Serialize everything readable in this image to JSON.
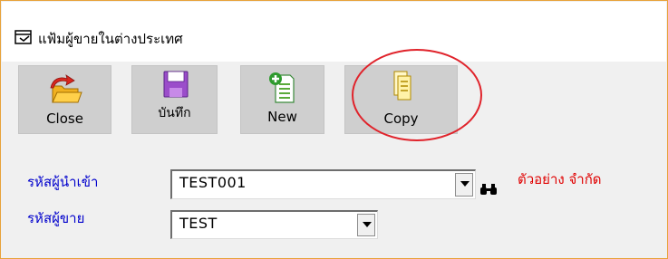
{
  "window": {
    "title": "แฟ้มผู้ขายในต่างประเทศ",
    "icon": "window-form-icon"
  },
  "toolbar": {
    "buttons": [
      {
        "label": "Close",
        "icon": "open-folder-arrow-icon"
      },
      {
        "label": "บันทึก",
        "icon": "floppy-disk-icon"
      },
      {
        "label": "New",
        "icon": "new-document-plus-icon"
      },
      {
        "label": "Copy",
        "icon": "copy-document-icon"
      }
    ]
  },
  "form": {
    "importer_code_label": "รหัสผู้นำเข้า",
    "importer_code_value": "TEST001",
    "seller_code_label": "รหัสผู้ขาย",
    "seller_code_value": "TEST",
    "company_name": "ตัวอย่าง จำกัด"
  },
  "colors": {
    "label_blue": "#0000cc",
    "company_red": "#e00000",
    "highlight_ring": "#e0232b",
    "toolbar_button_bg": "#cfcfcf",
    "window_border": "#e8a23a"
  }
}
